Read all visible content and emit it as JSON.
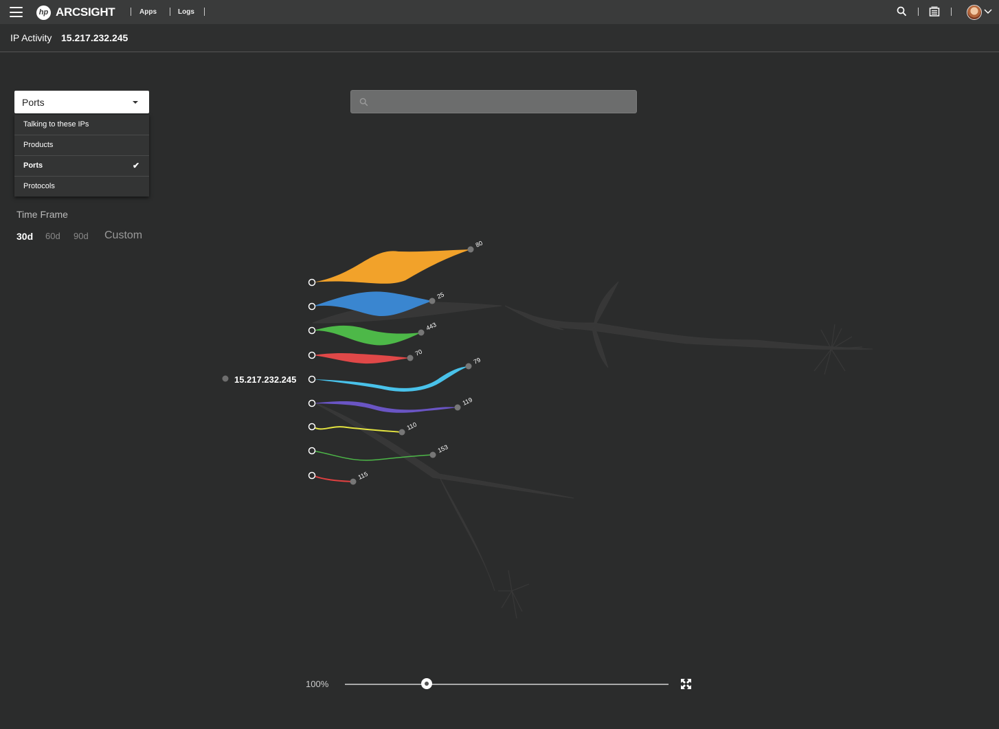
{
  "header": {
    "brand": "ARCSIGHT",
    "logo_mark": "hp",
    "nav": [
      "Apps",
      "Logs"
    ],
    "icons": [
      "menu-icon",
      "search-icon",
      "inbox-icon",
      "user-avatar",
      "chevron-down-icon"
    ]
  },
  "subheader": {
    "label": "IP Activity",
    "ip": "15.217.232.245"
  },
  "view_select": {
    "value": "Ports",
    "options": [
      "Talking to these IPs",
      "Products",
      "Ports",
      "Protocols"
    ],
    "selected_index": 2
  },
  "search": {
    "placeholder": "",
    "value": ""
  },
  "time_frame": {
    "title": "Time Frame",
    "options": [
      "30d",
      "60d",
      "90d"
    ],
    "active": "30d",
    "custom": "Custom"
  },
  "graph": {
    "source_ip": "15.217.232.245",
    "ports": [
      {
        "label": "80",
        "color": "#f2a22a"
      },
      {
        "label": "25",
        "color": "#3a86d0"
      },
      {
        "label": "443",
        "color": "#4db848"
      },
      {
        "label": "70",
        "color": "#e04848"
      },
      {
        "label": "79",
        "color": "#49c2ea"
      },
      {
        "label": "119",
        "color": "#6a55c4"
      },
      {
        "label": "110",
        "color": "#e6e640"
      },
      {
        "label": "153",
        "color": "#4db848"
      },
      {
        "label": "115",
        "color": "#e04040"
      }
    ]
  },
  "zoom": {
    "label": "100%",
    "level": 0.25
  }
}
